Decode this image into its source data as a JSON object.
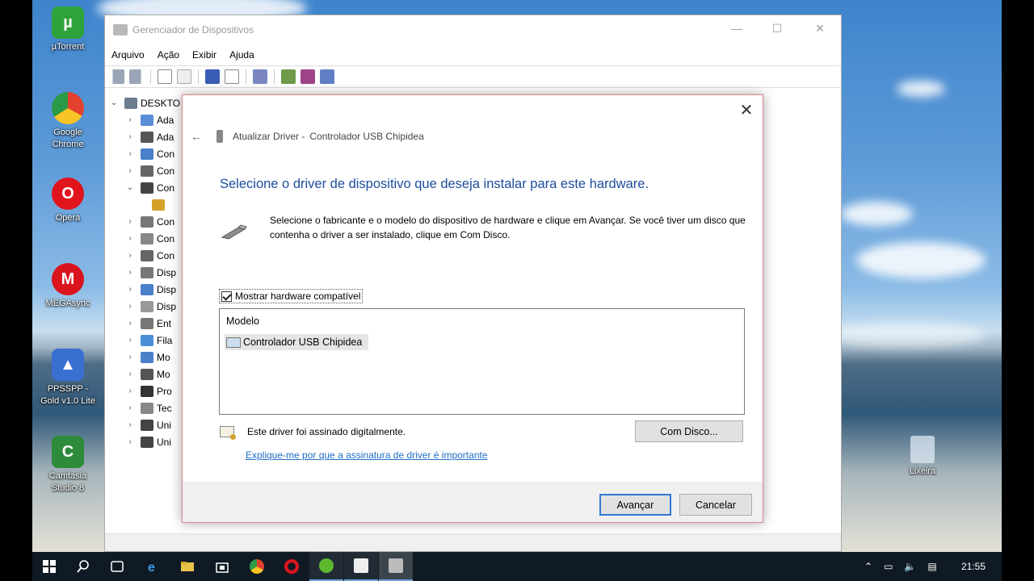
{
  "desktop": {
    "icons": [
      {
        "label": "µTorrent",
        "color": "#2fa33b",
        "glyph": "µ"
      },
      {
        "label": "Google Chrome",
        "color": "#e4402f",
        "glyph": "●"
      },
      {
        "label": "Opera",
        "color": "#e0141d",
        "glyph": "O"
      },
      {
        "label": "MEGAsync",
        "color": "#d9141c",
        "glyph": "M"
      },
      {
        "label": "PPSSPP - Gold v1.0 Lite",
        "color": "#3a6fd2",
        "glyph": "▲"
      },
      {
        "label": "Camtasia Studio 8",
        "color": "#2e8b3c",
        "glyph": "C"
      }
    ],
    "recycle_bin": "Lixeira"
  },
  "devmgr": {
    "title": "Gerenciador de Dispositivos",
    "menu": [
      "Arquivo",
      "Ação",
      "Exibir",
      "Ajuda"
    ],
    "tree_root": "DESKTO",
    "tree_items": [
      "Ada",
      "Ada",
      "Con",
      "Con",
      "Con",
      "",
      "Con",
      "Con",
      "Con",
      "Disp",
      "Disp",
      "Disp",
      "Ent",
      "Fila",
      "Mo",
      "Mo",
      "Pro",
      "Tec",
      "Uni",
      "Uni"
    ]
  },
  "wizard": {
    "breadcrumb_prefix": "Atualizar Driver -",
    "breadcrumb_device": "Controlador USB Chipidea",
    "heading": "Selecione o driver de dispositivo que deseja instalar para este hardware.",
    "description": "Selecione o fabricante e o modelo do dispositivo de hardware e clique em Avançar. Se você tiver um disco que contenha o driver a ser instalado, clique em Com Disco.",
    "compat_label": "Mostrar hardware compatível",
    "compat_checked": true,
    "list_header": "Modelo",
    "list_items": [
      "Controlador USB Chipidea"
    ],
    "signed_text": "Este driver foi assinado digitalmente.",
    "link_text": "Explique-me por que a assinatura de driver é importante",
    "have_disk_label": "Com Disco...",
    "next_label": "Avançar",
    "cancel_label": "Cancelar"
  },
  "taskbar": {
    "clock": "21:55",
    "apps": [
      "start-icon",
      "search-icon",
      "task-view-icon",
      "edge-icon",
      "file-explorer-icon",
      "store-icon",
      "chrome-icon",
      "opera-icon",
      "utorrent-icon",
      "camtasia-icon",
      "device-manager-icon"
    ]
  },
  "colors": {
    "accent_heading": "#1c4d9d",
    "link": "#1f6fc5",
    "taskbar": "#101a24"
  }
}
